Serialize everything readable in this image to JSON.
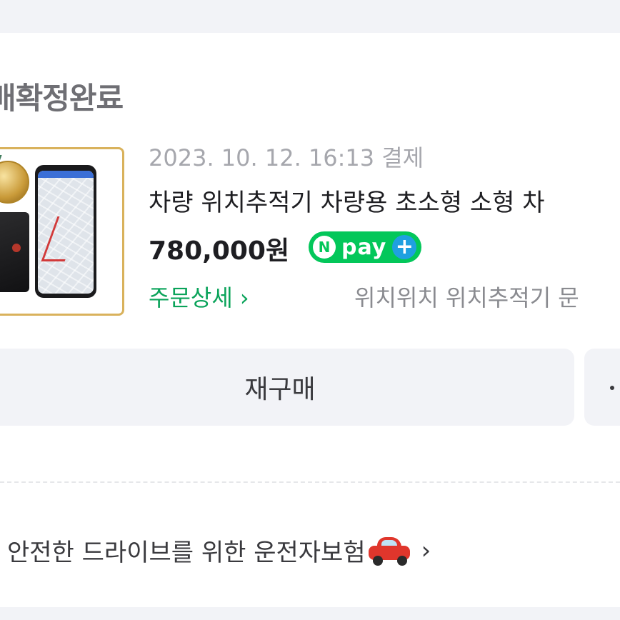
{
  "order": {
    "status": "배확정완료",
    "date": "2023. 10. 12. 16:13 결제",
    "product_name": "차량 위치추적기 차량용 초소형 소형 차",
    "price": "780,000원",
    "npay": {
      "n": "N",
      "text": "pay",
      "plus": "+"
    },
    "order_detail_label": "주문상세 ›",
    "seller_info": "위치위치 위치추적기 문",
    "rebuy_label": "재구매"
  },
  "promo": {
    "insurance_text": "안전한 드라이브를 위한 운전자보험",
    "chevron": "›"
  },
  "colors": {
    "background": "#f2f3f7",
    "card": "#ffffff",
    "accent_green": "#0aa35a",
    "npay_green": "#03c75a",
    "npay_blue": "#1fa0e0"
  }
}
